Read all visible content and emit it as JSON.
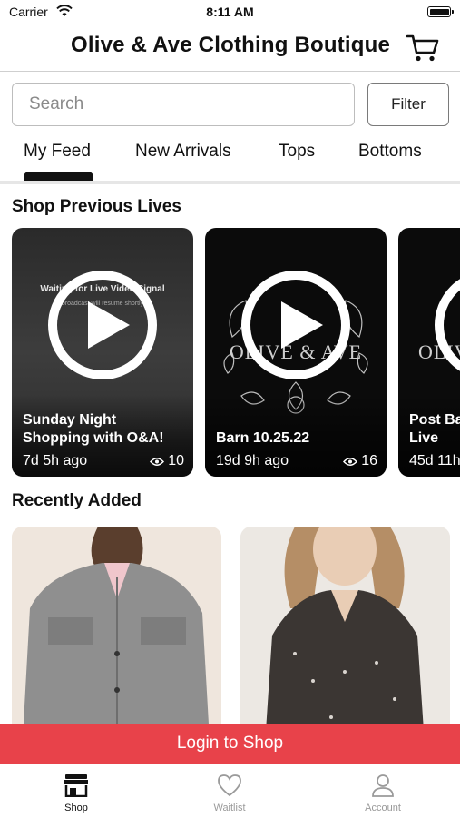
{
  "status_bar": {
    "carrier": "Carrier",
    "time": "8:11 AM"
  },
  "header": {
    "title": "Olive & Ave Clothing Boutique"
  },
  "search": {
    "placeholder": "Search",
    "filter_label": "Filter"
  },
  "tabs": [
    {
      "label": "My Feed",
      "active": true
    },
    {
      "label": "New Arrivals"
    },
    {
      "label": "Tops"
    },
    {
      "label": "Bottoms"
    }
  ],
  "sections": {
    "previous_lives": "Shop Previous Lives",
    "recently_added": "Recently Added"
  },
  "lives": [
    {
      "title": "Sunday Night Shopping with O&A!",
      "age": "7d 5h ago",
      "views": "10",
      "overlay_title": "Waiting for Live Video Signal",
      "overlay_subtitle": "broadcast will resume shortly"
    },
    {
      "title": "Barn 10.25.22",
      "age": "19d 9h ago",
      "views": "16",
      "brand_art_text": "OLIVE & AVE"
    },
    {
      "title": "Post Ba Live",
      "age": "45d 11h",
      "brand_art_text": "OLIV"
    }
  ],
  "login_banner": "Login to Shop",
  "bottom_nav": [
    {
      "label": "Shop",
      "icon": "storefront-icon",
      "active": true
    },
    {
      "label": "Waitlist",
      "icon": "heart-icon"
    },
    {
      "label": "Account",
      "icon": "person-icon"
    }
  ],
  "colors": {
    "accent_red": "#e8424a",
    "text_dark": "#111111",
    "inactive_nav": "#9a9a9a"
  }
}
